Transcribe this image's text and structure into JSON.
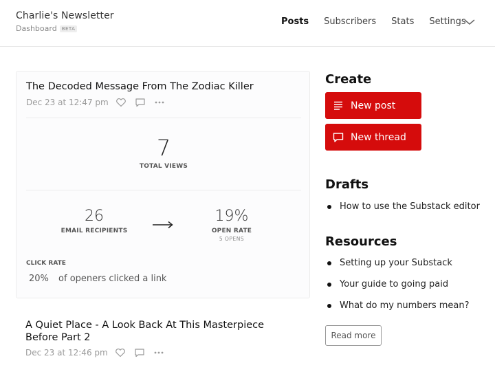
{
  "header": {
    "title": "Charlie's Newsletter",
    "subtitle": "Dashboard",
    "badge": "BETA",
    "nav": [
      {
        "label": "Posts",
        "active": true
      },
      {
        "label": "Subscribers",
        "active": false
      },
      {
        "label": "Stats",
        "active": false
      },
      {
        "label": "Settings",
        "active": false
      }
    ],
    "chevron_icon": "chevron-down-icon"
  },
  "post1": {
    "title": "The Decoded Message From The Zodiac Killer",
    "date": "Dec 23 at 12:47 pm",
    "icons": [
      "heart-icon",
      "comment-icon",
      "more-icon"
    ],
    "total_views": "7",
    "total_views_label": "TOTAL VIEWS",
    "email_recipients": "26",
    "email_recipients_label": "EMAIL RECIPIENTS",
    "open_rate": "19%",
    "open_rate_label": "OPEN RATE",
    "opens": "5 OPENS",
    "click_rate_label": "CLICK RATE",
    "click_rate": "20%",
    "click_rate_text": "of openers clicked a link"
  },
  "post2": {
    "title": "A Quiet Place - A Look Back At This Masterpiece Before Part 2",
    "date": "Dec 23 at 12:46 pm",
    "icons": [
      "heart-icon",
      "comment-icon",
      "more-icon"
    ]
  },
  "sidebar": {
    "create_title": "Create",
    "new_post": "New post",
    "new_thread": "New thread",
    "drafts_title": "Drafts",
    "drafts": [
      "How to use the Substack editor"
    ],
    "resources_title": "Resources",
    "resources": [
      "Setting up your Substack",
      "Your guide to going paid",
      "What do my numbers mean?"
    ],
    "read_more": "Read more",
    "accent_color": "#d50c0c"
  }
}
